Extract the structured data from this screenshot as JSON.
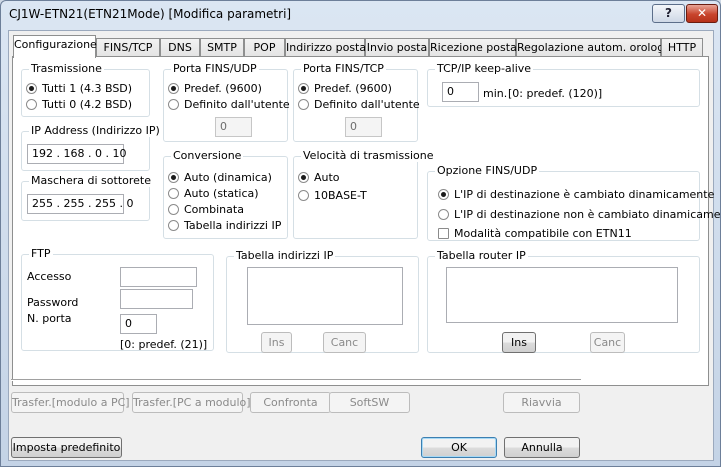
{
  "window": {
    "title": "CJ1W-ETN21(ETN21Mode) [Modifica parametri]",
    "help_label": "?",
    "close_label": "✕"
  },
  "tabs": [
    {
      "label": "Configurazione"
    },
    {
      "label": "FINS/TCP"
    },
    {
      "label": "DNS"
    },
    {
      "label": "SMTP"
    },
    {
      "label": "POP"
    },
    {
      "label": "Indirizzo posta"
    },
    {
      "label": "Invio posta"
    },
    {
      "label": "Ricezione posta"
    },
    {
      "label": "Regolazione autom. orologio"
    },
    {
      "label": "HTTP"
    }
  ],
  "trasmissione": {
    "label": "Trasmissione",
    "options": [
      "Tutti 1 (4.3 BSD)",
      "Tutti 0 (4.2 BSD)"
    ]
  },
  "ip_address": {
    "label": "IP Address (Indirizzo IP)",
    "value": "192 . 168 .  0  . 10"
  },
  "subnet": {
    "label": "Maschera di sottorete",
    "value": "255 . 255 . 255 .  0"
  },
  "porta_udp": {
    "label": "Porta FINS/UDP",
    "options": [
      "Predef. (9600)",
      "Definito dall'utente"
    ],
    "value": "0"
  },
  "porta_tcp": {
    "label": "Porta FINS/TCP",
    "options": [
      "Predef. (9600)",
      "Definito dall'utente"
    ],
    "value": "0"
  },
  "keepalive": {
    "label": "TCP/IP keep-alive",
    "value": "0",
    "unit": "min.",
    "hint": "[0: predef. (120)]"
  },
  "conversione": {
    "label": "Conversione",
    "options": [
      "Auto (dinamica)",
      "Auto (statica)",
      "Combinata",
      "Tabella indirizzi IP"
    ]
  },
  "velocita": {
    "label": "Velocità di trasmissione",
    "options": [
      "Auto",
      "10BASE-T"
    ]
  },
  "opzione_udp": {
    "label": "Opzione FINS/UDP",
    "options": [
      "L'IP di destinazione è cambiato dinamicamente",
      "L'IP di destinazione non è cambiato dinamicamente",
      "Modalità compatibile con ETN11"
    ]
  },
  "ftp": {
    "label": "FTP",
    "access_label": "Accesso",
    "password_label": "Password",
    "port_label": "N. porta",
    "port_value": "0",
    "hint": "[0: predef. (21)]"
  },
  "tabella_ip": {
    "label": "Tabella indirizzi IP",
    "ins": "Ins",
    "canc": "Canc"
  },
  "tabella_router": {
    "label": "Tabella router IP",
    "ins": "Ins",
    "canc": "Canc"
  },
  "actions": {
    "transfer_to_pc": "Trasfer.[modulo a PC]",
    "transfer_to_module": "Trasfer.[PC a modulo]",
    "compare": "Confronta",
    "softsw": "SoftSW",
    "restart": "Riavvia",
    "default": "Imposta predefinito",
    "ok": "OK",
    "cancel": "Annulla"
  }
}
